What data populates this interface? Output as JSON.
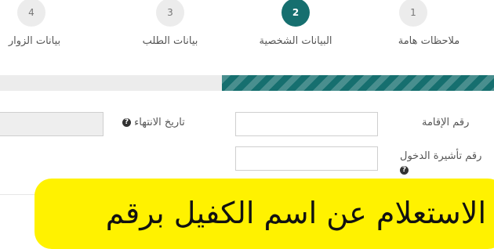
{
  "steps": [
    {
      "number": "1",
      "label": "ملاحظات هامة"
    },
    {
      "number": "2",
      "label": "البيانات الشخصية"
    },
    {
      "number": "3",
      "label": "بيانات الطلب"
    },
    {
      "number": "4",
      "label": "بيانات الزوار"
    }
  ],
  "progress": {
    "percent": 55,
    "color": "#166f6f"
  },
  "form": {
    "iqama_label": "رقم الإقامة",
    "iqama_value": "",
    "expiry_label": "تاريخ الانتهاء",
    "expiry_value": "",
    "entry_visa_label": "رقم تأشيرة الدخول",
    "entry_visa_value": "",
    "help_glyph": "?"
  },
  "banner": {
    "text": "الاستعلام عن اسم الكفيل برقم",
    "color": "#fff200"
  }
}
